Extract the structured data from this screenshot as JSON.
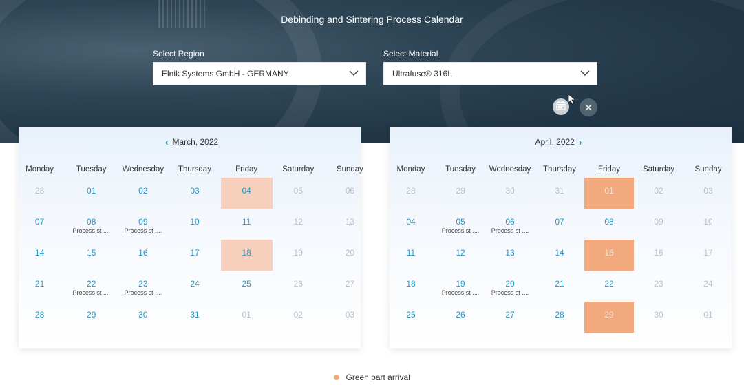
{
  "title": "Debinding and Sintering Process Calendar",
  "region": {
    "label": "Select Region",
    "value": "Elnik Systems GmbH - GERMANY"
  },
  "material": {
    "label": "Select Material",
    "value": "Ultrafuse® 316L"
  },
  "icons": {
    "calendar": "calendar-icon",
    "close": "close-icon",
    "prev": "chevron-left-icon",
    "next": "chevron-right-icon",
    "dropdown": "chevron-down-icon"
  },
  "colors": {
    "accent": "#2596c4",
    "highlight_light": "#f6d0bd",
    "highlight_strong": "#f3a97e",
    "header_bg": "#213747"
  },
  "weekdays": [
    "Monday",
    "Tuesday",
    "Wednesday",
    "Thursday",
    "Friday",
    "Saturday",
    "Sunday"
  ],
  "march": {
    "title": "March, 2022",
    "weeks": [
      [
        {
          "d": "28",
          "o": true
        },
        {
          "d": "01"
        },
        {
          "d": "02"
        },
        {
          "d": "03"
        },
        {
          "d": "04",
          "h": "light"
        },
        {
          "d": "05",
          "w": true
        },
        {
          "d": "06",
          "w": true
        }
      ],
      [
        {
          "d": "07"
        },
        {
          "d": "08",
          "s": "Process st ...."
        },
        {
          "d": "09",
          "s": "Process st ...."
        },
        {
          "d": "10"
        },
        {
          "d": "11"
        },
        {
          "d": "12",
          "w": true
        },
        {
          "d": "13",
          "w": true
        }
      ],
      [
        {
          "d": "14"
        },
        {
          "d": "15"
        },
        {
          "d": "16"
        },
        {
          "d": "17"
        },
        {
          "d": "18",
          "h": "light"
        },
        {
          "d": "19",
          "w": true
        },
        {
          "d": "20",
          "w": true
        }
      ],
      [
        {
          "d": "21"
        },
        {
          "d": "22",
          "s": "Process st ...."
        },
        {
          "d": "23",
          "s": "Process st ...."
        },
        {
          "d": "24"
        },
        {
          "d": "25"
        },
        {
          "d": "26",
          "w": true
        },
        {
          "d": "27",
          "w": true
        }
      ],
      [
        {
          "d": "28"
        },
        {
          "d": "29"
        },
        {
          "d": "30"
        },
        {
          "d": "31"
        },
        {
          "d": "01",
          "o": true
        },
        {
          "d": "02",
          "o": true
        },
        {
          "d": "03",
          "o": true
        }
      ]
    ]
  },
  "april": {
    "title": "April, 2022",
    "weeks": [
      [
        {
          "d": "28",
          "o": true
        },
        {
          "d": "29",
          "o": true
        },
        {
          "d": "30",
          "o": true
        },
        {
          "d": "31",
          "o": true
        },
        {
          "d": "01",
          "h": "strong",
          "dim": true
        },
        {
          "d": "02",
          "w": true
        },
        {
          "d": "03",
          "w": true
        }
      ],
      [
        {
          "d": "04"
        },
        {
          "d": "05",
          "s": "Process st ...."
        },
        {
          "d": "06",
          "s": "Process st ...."
        },
        {
          "d": "07"
        },
        {
          "d": "08"
        },
        {
          "d": "09",
          "w": true
        },
        {
          "d": "10",
          "w": true
        }
      ],
      [
        {
          "d": "11"
        },
        {
          "d": "12"
        },
        {
          "d": "13"
        },
        {
          "d": "14"
        },
        {
          "d": "15",
          "h": "strong",
          "dim": true
        },
        {
          "d": "16",
          "w": true
        },
        {
          "d": "17",
          "w": true
        }
      ],
      [
        {
          "d": "18"
        },
        {
          "d": "19",
          "s": "Process st ...."
        },
        {
          "d": "20",
          "s": "Process st ...."
        },
        {
          "d": "21"
        },
        {
          "d": "22"
        },
        {
          "d": "23",
          "w": true
        },
        {
          "d": "24",
          "w": true
        }
      ],
      [
        {
          "d": "25"
        },
        {
          "d": "26"
        },
        {
          "d": "27"
        },
        {
          "d": "28"
        },
        {
          "d": "29",
          "h": "strong",
          "dim": true
        },
        {
          "d": "30",
          "w": true
        },
        {
          "d": "01",
          "o": true
        }
      ]
    ]
  },
  "legend": {
    "label": "Green part arrival"
  }
}
